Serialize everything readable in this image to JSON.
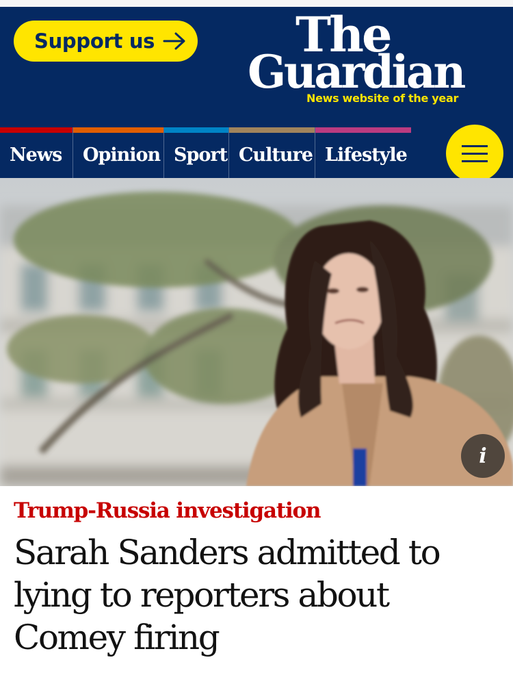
{
  "header": {
    "support_button": {
      "label": "Support us",
      "icon": "arrow-right-icon"
    },
    "logo": {
      "line1": "The",
      "line2": "Guardian",
      "tagline": "News website of the year"
    }
  },
  "nav": {
    "items": [
      {
        "label": "News",
        "color": "#c70000"
      },
      {
        "label": "Opinion",
        "color": "#e05e00"
      },
      {
        "label": "Sport",
        "color": "#0084c6"
      },
      {
        "label": "Culture",
        "color": "#a1845c"
      },
      {
        "label": "Lifestyle",
        "color": "#bb3b80"
      }
    ],
    "menu_icon": "hamburger-menu-icon"
  },
  "article": {
    "image_info_label": "i",
    "kicker": "Trump-Russia investigation",
    "headline": "Sarah Sanders admitted to lying to reporters about Comey firing"
  },
  "colors": {
    "brand_blue": "#052962",
    "brand_yellow": "#ffe500",
    "kicker_red": "#c70000"
  }
}
